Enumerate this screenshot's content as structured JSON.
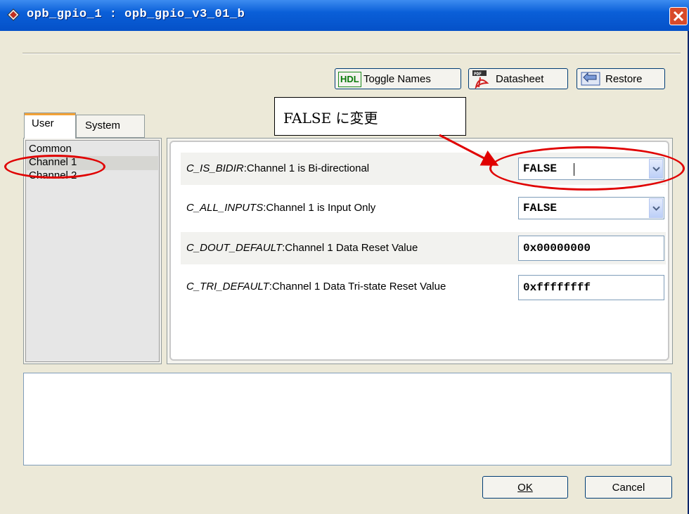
{
  "window": {
    "title": "opb_gpio_1 : opb_gpio_v3_01_b",
    "close_label": "Close"
  },
  "toolbar": {
    "toggle_badge": "HDL",
    "toggle_label": "Toggle Names",
    "datasheet_badge": "PDF",
    "datasheet_label": "Datasheet",
    "restore_label": "Restore"
  },
  "annotation": {
    "callout_text": "FALSE に変更",
    "highlight_color": "#e00000"
  },
  "tabs": [
    {
      "label": "User",
      "selected": true
    },
    {
      "label": "System",
      "selected": false
    }
  ],
  "categories": [
    {
      "label": "Common"
    },
    {
      "label": "Channel 1"
    },
    {
      "label": "Channel 2"
    }
  ],
  "selected_category": "Channel 1",
  "params": [
    {
      "name": "C_IS_BIDIR",
      "desc": ":Channel 1 is Bi-directional",
      "control": "combo",
      "value": "FALSE"
    },
    {
      "name": "C_ALL_INPUTS",
      "desc": ":Channel 1 is Input Only",
      "control": "combo",
      "value": "FALSE"
    },
    {
      "name": "C_DOUT_DEFAULT",
      "desc": ":Channel 1 Data Reset Value",
      "control": "text",
      "value": "0x00000000"
    },
    {
      "name": "C_TRI_DEFAULT",
      "desc": ":Channel 1 Data Tri-state Reset Value",
      "control": "text",
      "value": "0xffffffff"
    }
  ],
  "buttons": {
    "ok_label": "OK",
    "cancel_label": "Cancel"
  },
  "icons": [
    "app-icon",
    "close-icon",
    "hdl-icon",
    "pdf-icon",
    "restore-icon",
    "chevron-down-icon"
  ]
}
